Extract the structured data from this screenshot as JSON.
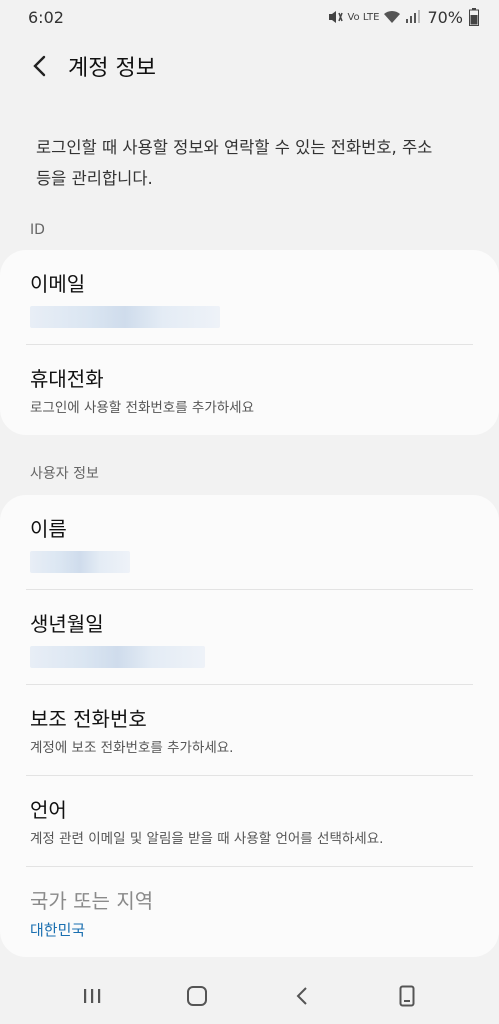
{
  "status": {
    "time": "6:02",
    "battery": "70%",
    "network": "Vo LTE"
  },
  "header": {
    "title": "계정 정보"
  },
  "description": "로그인할 때 사용할 정보와 연락할 수 있는 전화번호, 주소 등을 관리합니다.",
  "sections": {
    "id_label": "ID",
    "user_label": "사용자 정보"
  },
  "id_items": {
    "email_title": "이메일",
    "phone_title": "휴대전화",
    "phone_sub": "로그인에 사용할 전화번호를 추가하세요"
  },
  "user_items": {
    "name_title": "이름",
    "birthday_title": "생년월일",
    "backup_phone_title": "보조 전화번호",
    "backup_phone_sub": "계정에 보조 전화번호를 추가하세요.",
    "language_title": "언어",
    "language_sub": "계정 관련 이메일 및 알림을 받을 때 사용할 언어를 선택하세요.",
    "region_title": "국가 또는 지역",
    "region_value": "대한민국"
  },
  "colors": {
    "background": "#f2f2f2",
    "card": "#fbfbfb",
    "accent": "#1a6fb0"
  },
  "icons": {
    "back": "back-arrow-icon",
    "nav_recent": "recent-apps-icon",
    "nav_home": "home-icon",
    "nav_back": "nav-back-icon",
    "nav_keyboard": "keyboard-toggle-icon"
  }
}
